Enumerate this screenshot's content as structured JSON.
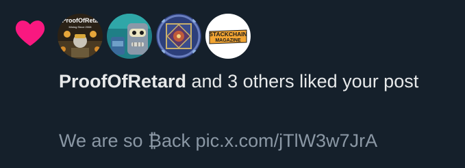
{
  "notification": {
    "actor_name": "ProofOfRetard",
    "action_text": " and 3 others liked your post",
    "preview_text": "We are so ₿ack pic.x.com/jTlW3w7JrA"
  },
  "avatars": [
    {
      "label": "ProofOfRetard",
      "image_text": "ProofOfReta",
      "sub_text": "Mining Since 2008"
    },
    {
      "label": "robot-avatar"
    },
    {
      "label": "mandala-avatar"
    },
    {
      "label": "stackchain-avatar",
      "image_text_1": "STACKCHAIN",
      "image_text_2": "MAGAZINE"
    }
  ],
  "colors": {
    "background": "#15202b",
    "heart": "#f91880",
    "primary_text": "#e7e9ea",
    "secondary_text": "#8b98a5"
  },
  "icons": {
    "like": "heart-icon"
  }
}
